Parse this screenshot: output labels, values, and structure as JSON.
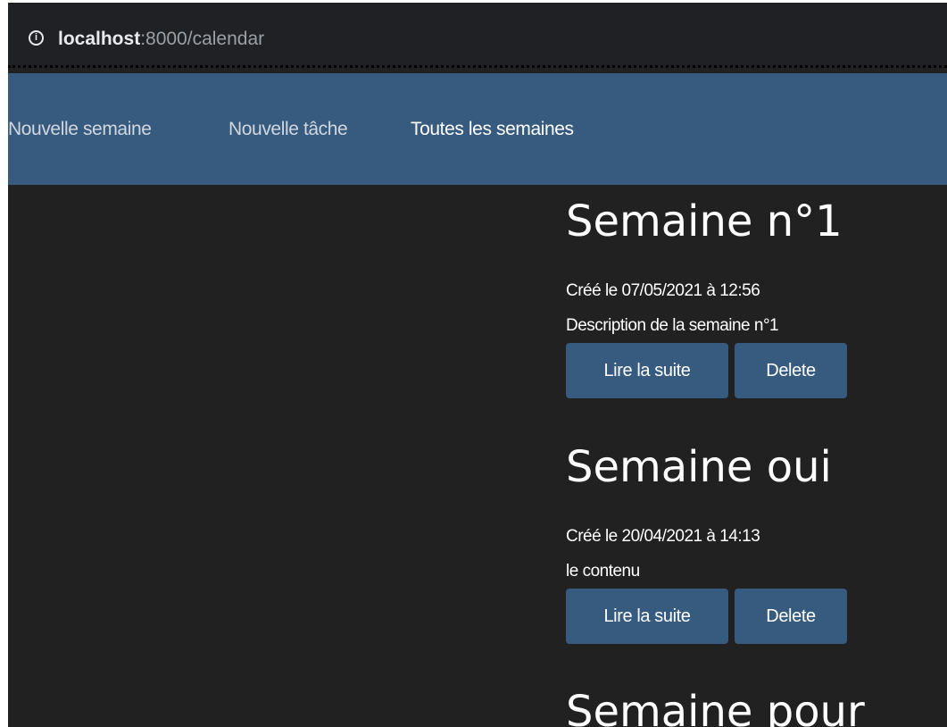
{
  "browser": {
    "url_host": "localhost",
    "url_rest": ":8000/calendar"
  },
  "navbar": {
    "links": [
      {
        "label": "Nouvelle semaine"
      },
      {
        "label": "Nouvelle tâche"
      },
      {
        "label": "Toutes les semaines"
      }
    ]
  },
  "weeks": [
    {
      "title": "Semaine n°1",
      "date": "Créé le 07/05/2021 à 12:56",
      "description": "Description de la semaine n°1",
      "read_label": "Lire la suite",
      "delete_label": "Delete"
    },
    {
      "title": "Semaine oui",
      "date": "Créé le 20/04/2021 à 14:13",
      "description": "le contenu",
      "read_label": "Lire la suite",
      "delete_label": "Delete"
    },
    {
      "title": "Semaine pour"
    }
  ],
  "colors": {
    "navbar": "#375a7f",
    "page_background": "#212121",
    "button": "#375a7f"
  }
}
